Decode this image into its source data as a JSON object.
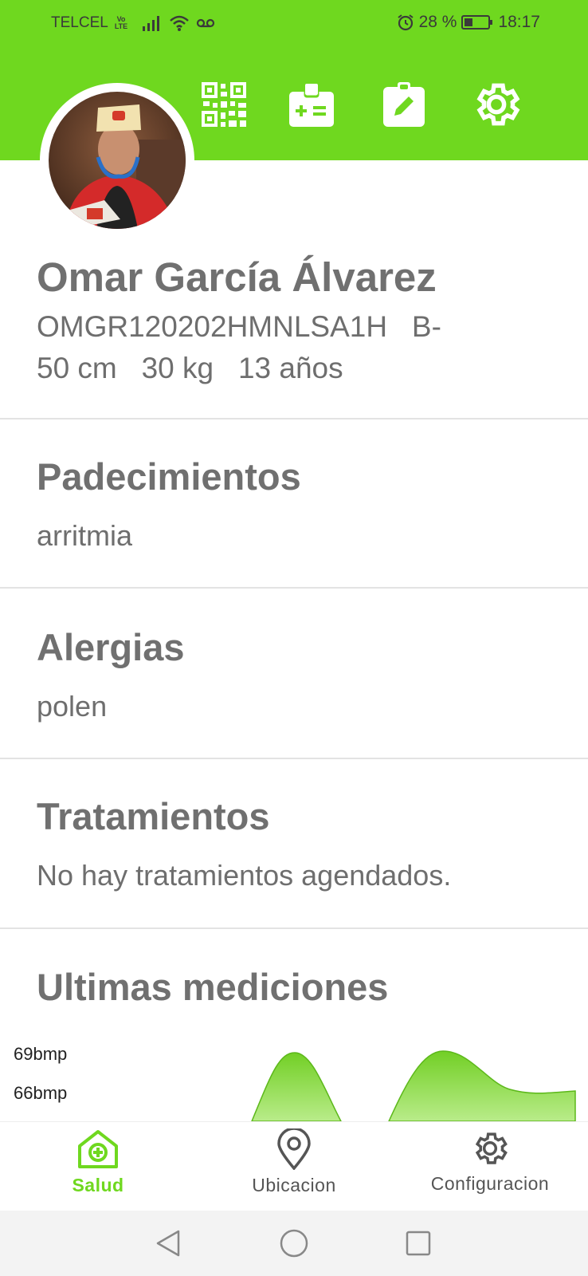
{
  "status_bar": {
    "carrier": "TELCEL",
    "volte_top": "Vo",
    "volte_bottom": "LTE",
    "battery": "28 %",
    "time": "18:17"
  },
  "header": {
    "actions": [
      "qr-code",
      "medical-id",
      "edit",
      "settings"
    ]
  },
  "profile": {
    "name": "Omar García Álvarez",
    "curp": "OMGR120202HMNLSA1H",
    "blood_type": "B-",
    "height": "50 cm",
    "weight": "30 kg",
    "age": "13 años"
  },
  "sections": {
    "conditions": {
      "title": "Padecimientos",
      "value": "arritmia"
    },
    "allergies": {
      "title": "Alergias",
      "value": "polen"
    },
    "treatments": {
      "title": "Tratamientos",
      "value": "No hay tratamientos agendados."
    },
    "measurements": {
      "title": "Ultimas mediciones"
    }
  },
  "chart_data": {
    "type": "area",
    "y_tick_labels": [
      "69bmp",
      "66bmp"
    ],
    "fill_color": "#7ed321"
  },
  "bottom_nav": {
    "items": [
      {
        "label": "Salud",
        "icon": "home-plus-icon",
        "active": true
      },
      {
        "label": "Ubicacion",
        "icon": "location-pin-icon",
        "active": false
      },
      {
        "label": "Configuracion",
        "icon": "gear-icon",
        "active": false
      }
    ]
  },
  "colors": {
    "accent": "#6fd81f",
    "text": "#707070"
  }
}
